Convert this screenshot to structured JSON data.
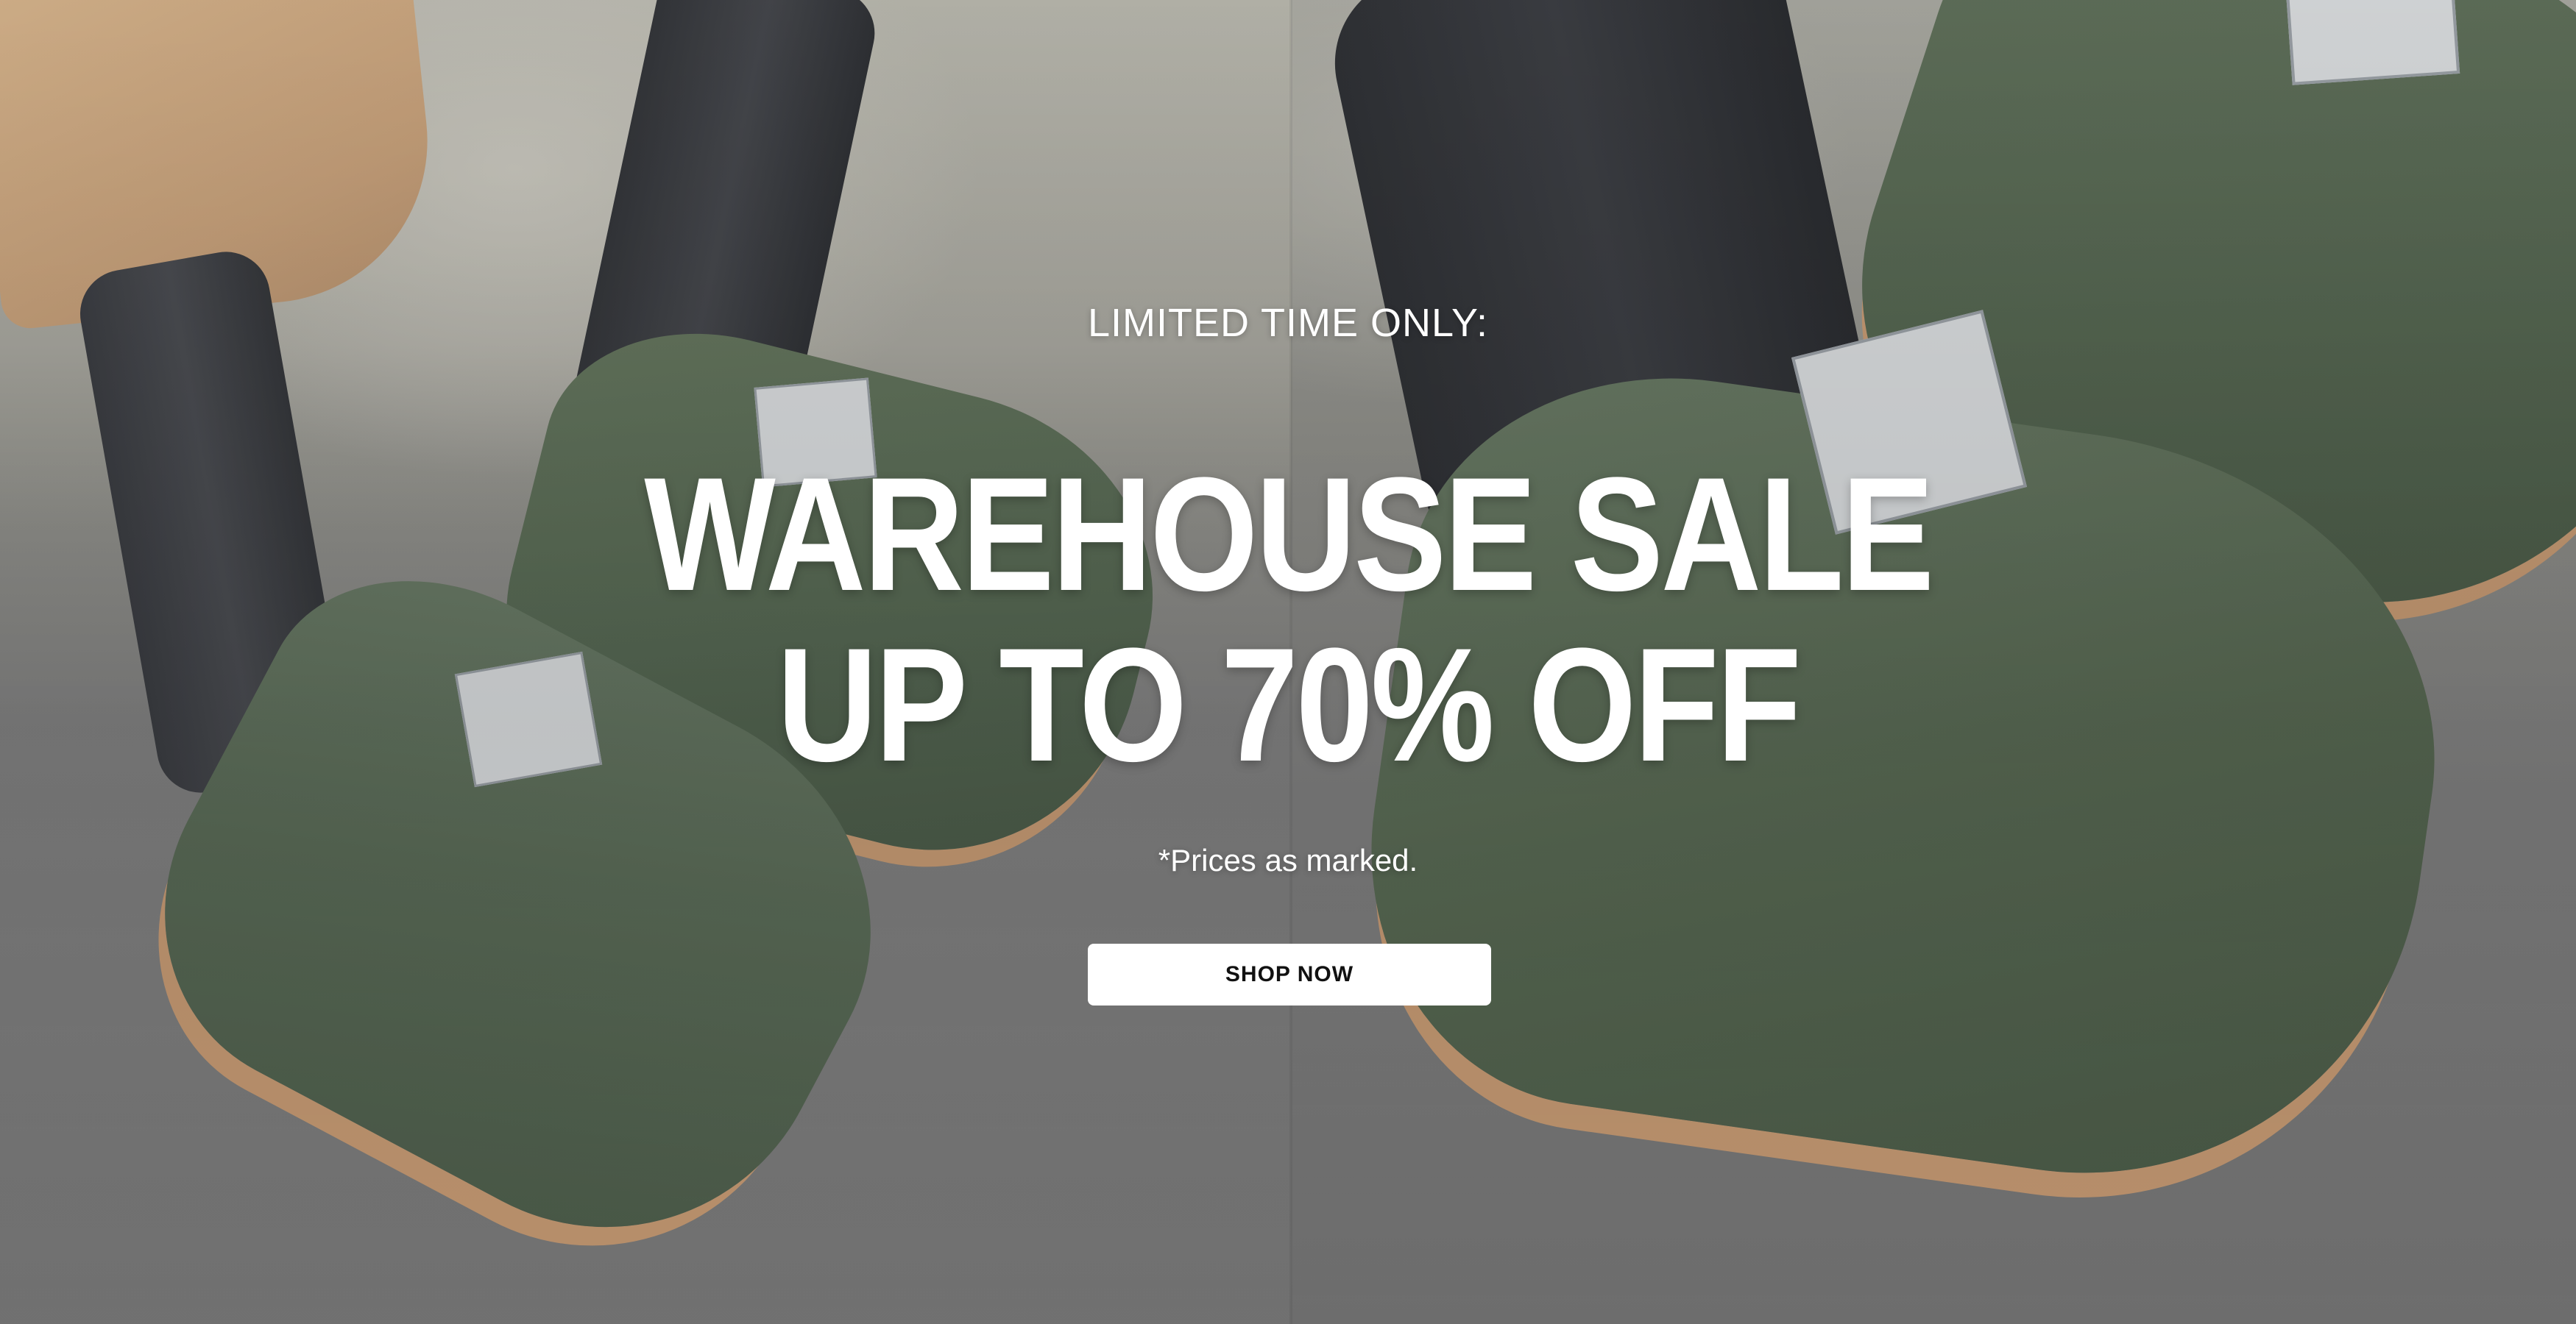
{
  "hero": {
    "eyebrow": "LIMITED TIME ONLY:",
    "headline_line1": "WAREHOUSE SALE",
    "headline_line2": "UP TO 70% OFF",
    "disclaimer": "*Prices as marked.",
    "cta_label": "SHOP NOW"
  },
  "colors": {
    "text": "#ffffff",
    "button_bg": "#ffffff",
    "button_text": "#111111",
    "shoe_green": "#5a6b57",
    "sole_tan": "#c79b74"
  }
}
